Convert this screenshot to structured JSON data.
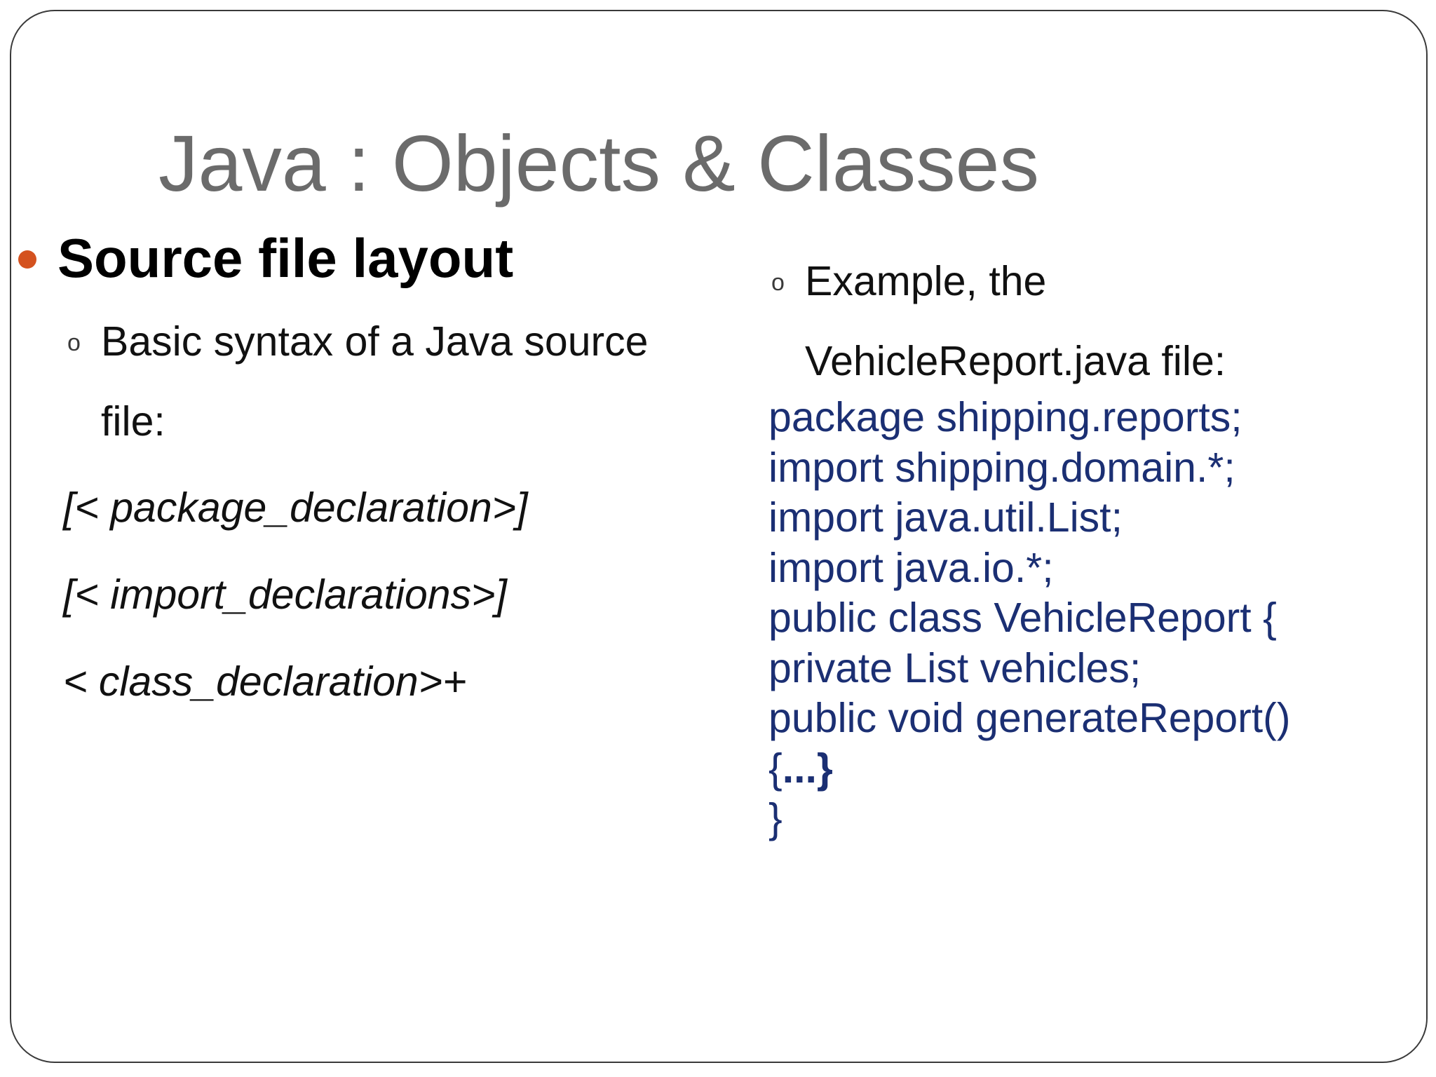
{
  "slide": {
    "title": "Java : Objects & Classes",
    "main_bullet": "Source file layout",
    "left_sub_bullet_line1": "Basic syntax of a Java source",
    "left_sub_bullet_line2": "file:",
    "syntax": [
      "[< package_declaration>]",
      "[< import_declarations>]",
      "< class_declaration>+"
    ],
    "right_sub_bullet_line1": "Example, the",
    "right_sub_bullet_line2": "VehicleReport.java file:",
    "code": [
      "package shipping.reports;",
      "import shipping.domain.*;",
      "import java.util.List;",
      "import java.io.*;",
      "public class VehicleReport {",
      "private List vehicles;",
      "public void generateReport()"
    ],
    "code_brace_open": "{",
    "code_ellipsis_close": "...}",
    "code_final_brace": "}",
    "sub_marker": "o"
  },
  "colors": {
    "title": "#6b6b6b",
    "bullet": "#d4521f",
    "code": "#1b2f73"
  }
}
